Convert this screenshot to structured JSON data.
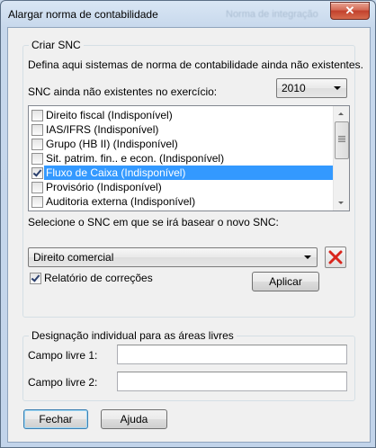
{
  "window": {
    "title": "Alargar norma de contabilidade",
    "close_glyph": "✕",
    "background_text": "Norma de integração"
  },
  "group_snc": {
    "title": "Criar SNC",
    "description": "Defina aqui sistemas de norma de contabilidade ainda não existentes.",
    "existing_label": "SNC ainda não existentes no exercício:",
    "year_select": {
      "value": "2010"
    },
    "list_items": [
      {
        "label": "Direito fiscal (Indisponível)",
        "checked": false,
        "selected": false
      },
      {
        "label": "IAS/IFRS (Indisponível)",
        "checked": false,
        "selected": false
      },
      {
        "label": "Grupo (HB II) (Indisponível)",
        "checked": false,
        "selected": false
      },
      {
        "label": "Sit. patrim. fin.. e econ. (Indisponível)",
        "checked": false,
        "selected": false
      },
      {
        "label": "Fluxo de Caixa  (Indisponível)",
        "checked": true,
        "selected": true
      },
      {
        "label": "Provisório (Indisponível)",
        "checked": false,
        "selected": false
      },
      {
        "label": "Auditoria externa (Indisponível)",
        "checked": false,
        "selected": false
      }
    ],
    "base_label": "Selecione o SNC em que se irá basear o novo SNC:",
    "base_select": {
      "value": "Direito comercial"
    },
    "corrections_checkbox": {
      "label": "Relatório de correções",
      "checked": true
    },
    "apply_button": "Aplicar"
  },
  "group_fields": {
    "title": "Designação individual para as áreas livres",
    "field1": {
      "label": "Campo livre 1:",
      "value": ""
    },
    "field2": {
      "label": "Campo livre 2:",
      "value": ""
    }
  },
  "buttons": {
    "close": "Fechar",
    "help": "Ajuda"
  },
  "colors": {
    "selection": "#3399ff",
    "delete_icon": "#d9251c"
  },
  "icons": {
    "delete": "red-x-icon",
    "dropdown": "chevron-down-icon"
  }
}
